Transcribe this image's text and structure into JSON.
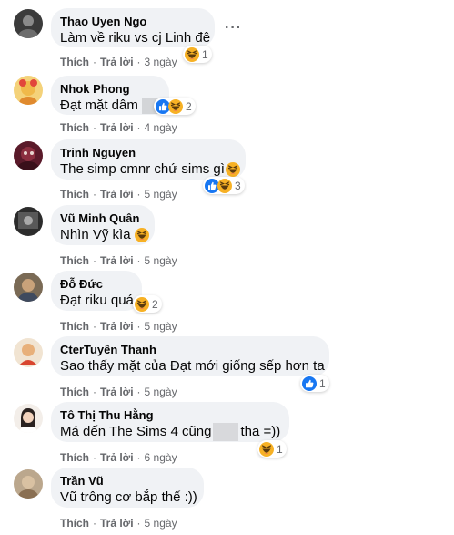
{
  "actions": {
    "like": "Thích",
    "reply": "Trả lời",
    "sep": "·"
  },
  "colors": {
    "bubble": "#f0f2f5",
    "meta": "#65676b",
    "like_blue": "#1877f2",
    "haha_yellow": "#f7b125"
  },
  "comments": [
    {
      "author": "Thao Uyen Ngo",
      "text": "Làm về riku vs cj Linh đê",
      "time": "3 ngày",
      "reactions": [
        "haha-icon"
      ],
      "count": "1"
    },
    {
      "author": "Nhok Phong",
      "text": "Đạt mặt dâm",
      "time": "4 ngày",
      "reactions": [
        "like-icon",
        "haha-icon"
      ],
      "count": "2"
    },
    {
      "author": "Trinh Nguyen",
      "text": "The simp cmnr chứ sims gì",
      "time": "5 ngày",
      "reactions": [
        "like-icon",
        "haha-icon"
      ],
      "count": "3"
    },
    {
      "author": "Vũ Minh Quân",
      "text": "Nhìn Vỹ kìa",
      "time": "5 ngày",
      "reactions": [],
      "count": ""
    },
    {
      "author": "Đỗ Đức",
      "text": "Đạt riku quá",
      "time": "5 ngày",
      "reactions": [
        "haha-icon"
      ],
      "count": "2"
    },
    {
      "author": "CterTuyền Thanh",
      "text": "Sao thấy mặt của Đạt mới giống sếp hơn ta",
      "time": "5 ngày",
      "reactions": [
        "like-icon"
      ],
      "count": "1"
    },
    {
      "author": "Tô Thị Thu Hằng",
      "text_a": "Má đến The Sims 4 cũng",
      "text_b": "tha =))",
      "time": "6 ngày",
      "reactions": [
        "haha-icon"
      ],
      "count": "1"
    },
    {
      "author": "Trần Vũ",
      "text": "Vũ trông cơ bắp thế :))",
      "time": "5 ngày",
      "reactions": [],
      "count": ""
    }
  ]
}
